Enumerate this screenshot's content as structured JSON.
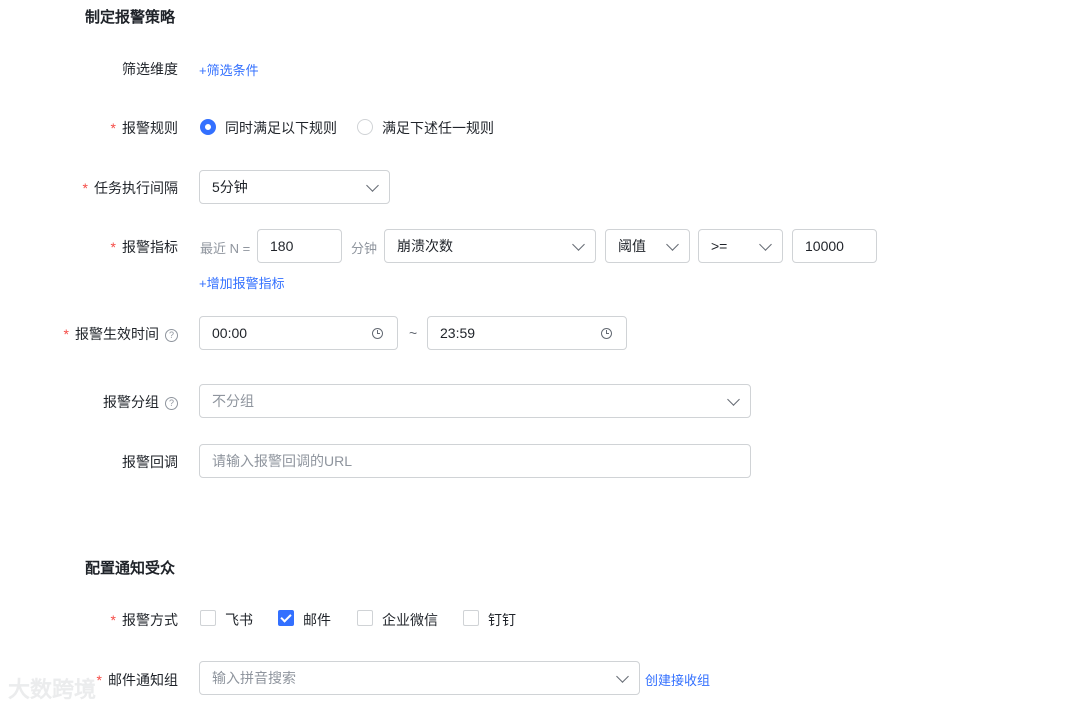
{
  "policy": {
    "title": "制定报警策略",
    "filter": {
      "label": "筛选维度",
      "link": "+筛选条件"
    },
    "rule": {
      "label": "报警规则",
      "options": [
        "同时满足以下规则",
        "满足下述任一规则"
      ],
      "selected_index": 0
    },
    "interval": {
      "label": "任务执行间隔",
      "value": "5分钟"
    },
    "metric": {
      "label": "报警指标",
      "prefix": "最近 N =",
      "n_value": "180",
      "unit": "分钟",
      "metric_value": "崩溃次数",
      "threshold_value": "阈值",
      "operator_value": ">=",
      "amount_value": "10000",
      "add_link": "+增加报警指标"
    },
    "effective_time": {
      "label": "报警生效时间",
      "start": "00:00",
      "separator": "~",
      "end": "23:59",
      "help": "?"
    },
    "group": {
      "label": "报警分组",
      "placeholder": "不分组",
      "help": "?"
    },
    "callback": {
      "label": "报警回调",
      "placeholder": "请输入报警回调的URL"
    }
  },
  "notify": {
    "title": "配置通知受众",
    "method": {
      "label": "报警方式",
      "options": [
        {
          "label": "飞书",
          "checked": false
        },
        {
          "label": "邮件",
          "checked": true
        },
        {
          "label": "企业微信",
          "checked": false
        },
        {
          "label": "钉钉",
          "checked": false
        }
      ]
    },
    "email_group": {
      "label": "邮件通知组",
      "placeholder": "输入拼音搜索",
      "create_link": "创建接收组"
    }
  },
  "required_mark": "*",
  "watermark": "大数跨境",
  "colors": {
    "accent": "#3370ff",
    "required": "#f54a45",
    "border": "#d0d3d6",
    "placeholder": "#8f959e"
  }
}
